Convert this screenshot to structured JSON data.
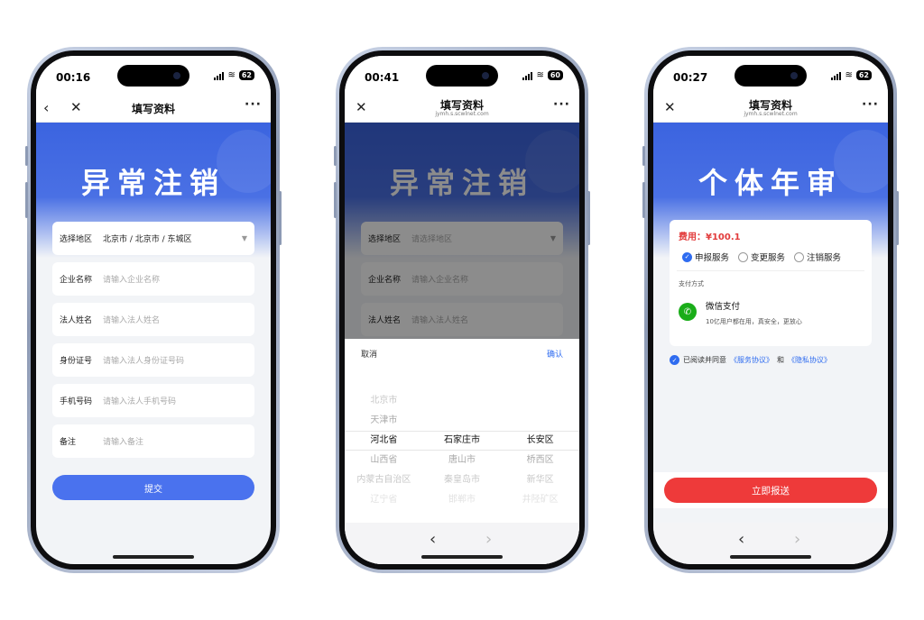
{
  "phone1": {
    "status": {
      "time": "00:16",
      "mute_icon": "bell-slash-icon",
      "battery": "62"
    },
    "nav": {
      "title": "填写资料",
      "back": "‹",
      "close": "✕",
      "more": "···"
    },
    "hero_title": "异常注销",
    "form": [
      {
        "label": "选择地区",
        "value": "北京市 / 北京市 / 东城区",
        "placeholder": ""
      },
      {
        "label": "企业名称",
        "value": "",
        "placeholder": "请输入企业名称"
      },
      {
        "label": "法人姓名",
        "value": "",
        "placeholder": "请输入法人姓名"
      },
      {
        "label": "身份证号",
        "value": "",
        "placeholder": "请输入法人身份证号码"
      },
      {
        "label": "手机号码",
        "value": "",
        "placeholder": "请输入法人手机号码"
      },
      {
        "label": "备注",
        "value": "",
        "placeholder": "请输入备注"
      }
    ],
    "submit": "提交"
  },
  "phone2": {
    "status": {
      "time": "00:41",
      "mute_icon": "bell-slash-icon",
      "battery": "60"
    },
    "nav": {
      "title": "填写资料",
      "url": "jymh.s.scwlnet.com",
      "close": "✕",
      "more": "···"
    },
    "hero_title": "异常注销",
    "form": [
      {
        "label": "选择地区",
        "placeholder": "请选择地区"
      },
      {
        "label": "企业名称",
        "placeholder": "请输入企业名称"
      },
      {
        "label": "法人姓名",
        "placeholder": "请输入法人姓名"
      }
    ],
    "picker": {
      "cancel": "取消",
      "confirm": "确认",
      "provinces": [
        "北京市",
        "天津市",
        "河北省",
        "山西省",
        "内蒙古自治区",
        "辽宁省"
      ],
      "cities": [
        "",
        "",
        "石家庄市",
        "唐山市",
        "秦皇岛市",
        "邯郸市"
      ],
      "districts": [
        "",
        "",
        "长安区",
        "桥西区",
        "新华区",
        "井陉矿区"
      ]
    },
    "bottom": {
      "back": "‹",
      "forward": "›"
    }
  },
  "phone3": {
    "status": {
      "time": "00:27",
      "mute_icon": "bell-slash-icon",
      "battery": "62"
    },
    "nav": {
      "title": "填写资料",
      "url": "jymh.s.scwlnet.com",
      "close": "✕",
      "more": "···"
    },
    "hero_title": "个体年审",
    "fee": "费用：¥100.1",
    "options": [
      {
        "label": "申报服务",
        "selected": true
      },
      {
        "label": "变更服务",
        "selected": false
      },
      {
        "label": "注销服务",
        "selected": false
      }
    ],
    "pay_label": "支付方式",
    "pay_name": "微信支付",
    "pay_desc": "10亿用户都在用，真安全，更放心",
    "agree_prefix": "已阅读并同意",
    "agree_link1": "《服务协议》",
    "agree_and": "和",
    "agree_link2": "《隐私协议》",
    "report": "立即报送",
    "bottom": {
      "back": "‹",
      "forward": "›"
    }
  },
  "colors": {
    "primary": "#4a72ee",
    "danger": "#ee3a3a",
    "wechat": "#1aad19",
    "link": "#2f6cf0"
  }
}
